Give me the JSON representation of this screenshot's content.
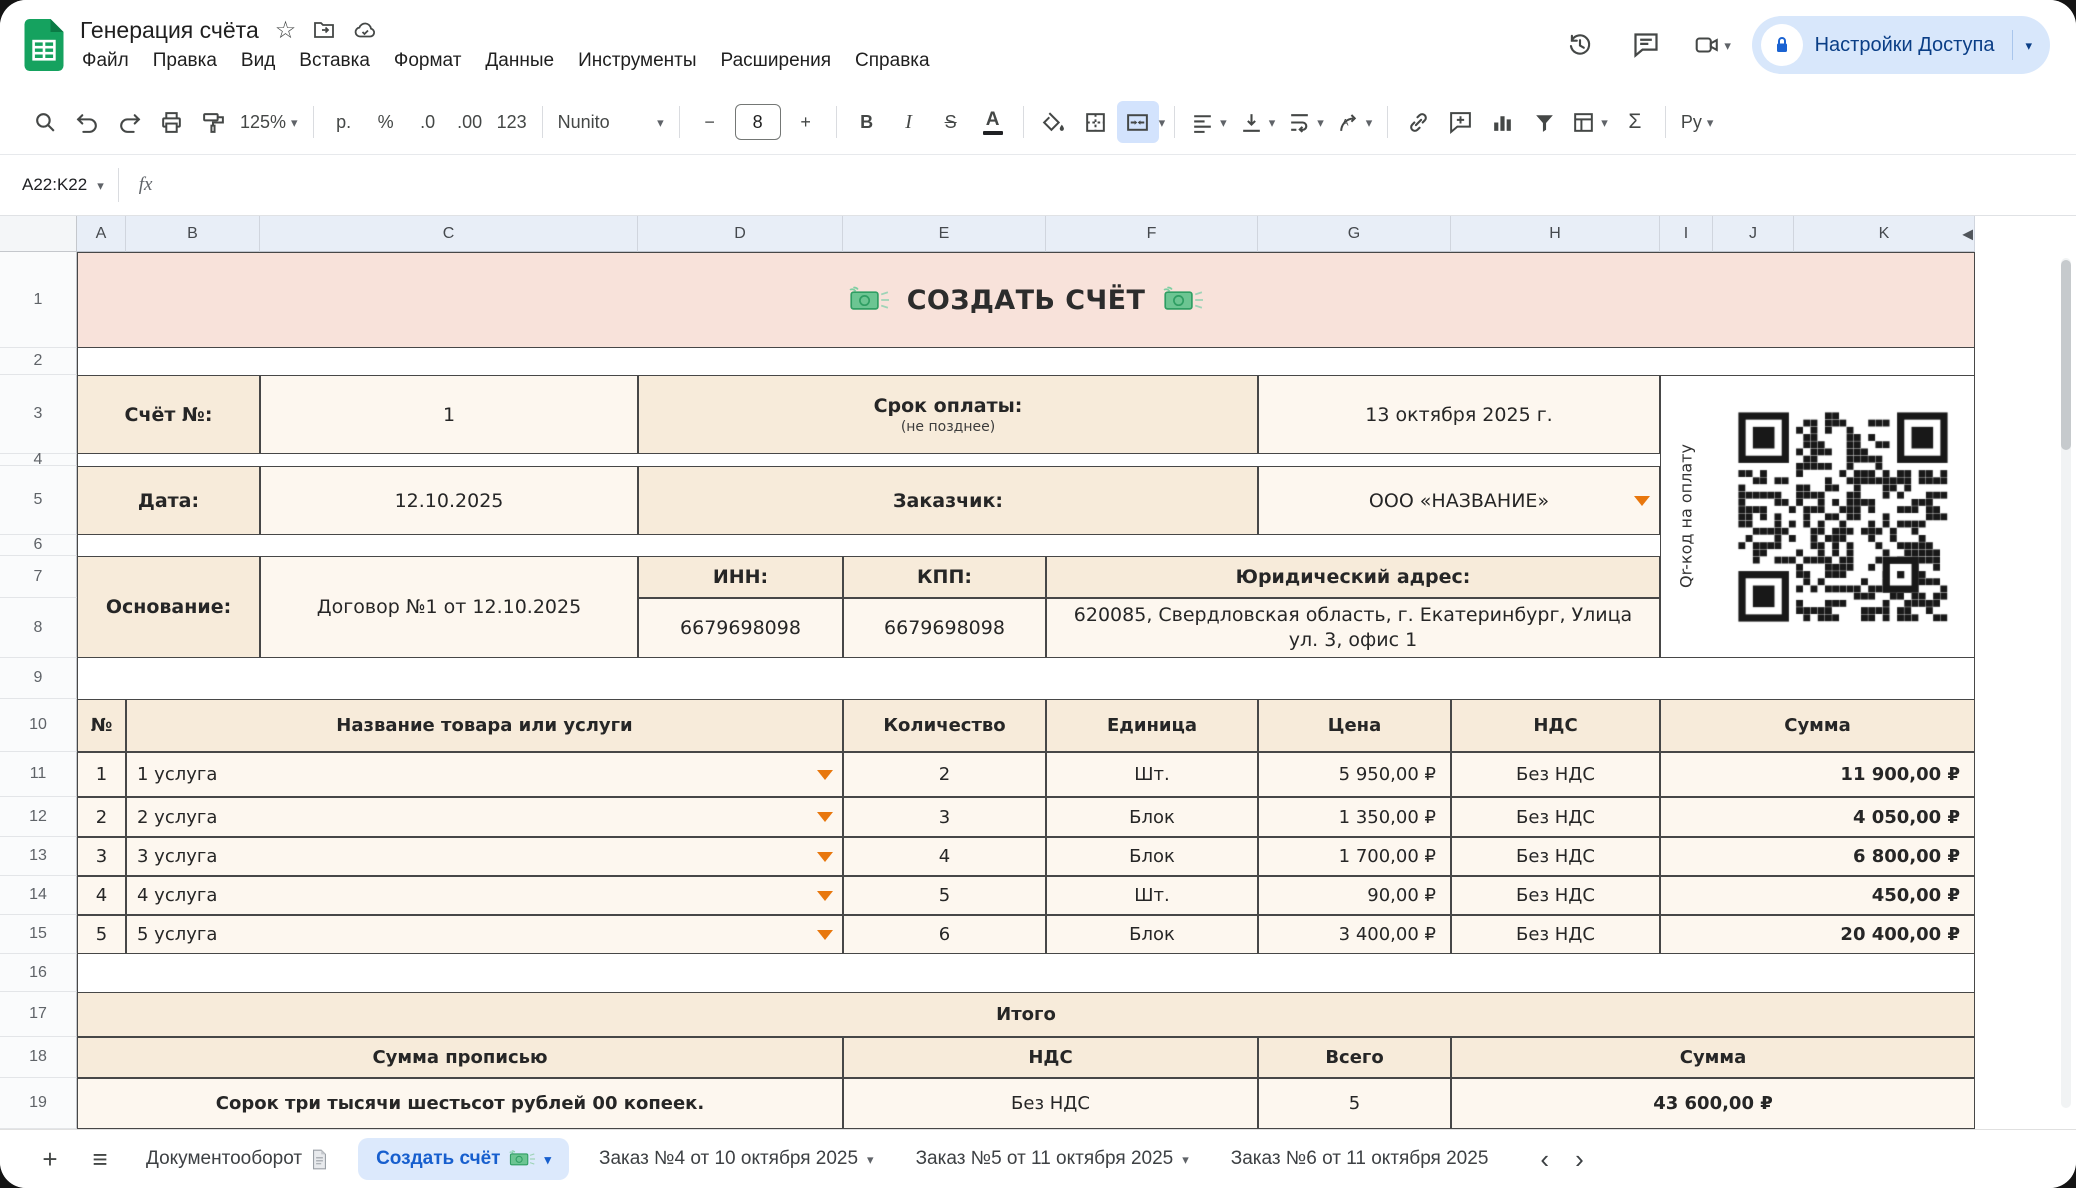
{
  "header": {
    "title": "Генерация счёта",
    "menus": [
      "Файл",
      "Правка",
      "Вид",
      "Вставка",
      "Формат",
      "Данные",
      "Инструменты",
      "Расширения",
      "Справка"
    ],
    "share_button": "Настройки Доступа"
  },
  "toolbar": {
    "zoom": "125%",
    "currency": "р.",
    "percent": "%",
    "dec_decrease": ".0",
    "dec_increase": ".00",
    "format_123": "123",
    "font": "Nunito",
    "font_size": "8",
    "sigma": "Σ",
    "input_lang": "Ру"
  },
  "formula_bar": {
    "name_box": "A22:K22",
    "fx": "fx"
  },
  "grid": {
    "columns": [
      "A",
      "B",
      "C",
      "D",
      "E",
      "F",
      "G",
      "H",
      "I",
      "J",
      "K"
    ],
    "rows": [
      "1",
      "2",
      "3",
      "4",
      "5",
      "6",
      "7",
      "8",
      "9",
      "10",
      "11",
      "12",
      "13",
      "14",
      "15",
      "16",
      "17",
      "18",
      "19"
    ],
    "col_marker": "◀"
  },
  "icons": {
    "caret": "▾",
    "plus": "+",
    "minus": "−",
    "hamburger": "≡",
    "star": "☆",
    "scroll_left": "‹",
    "scroll_right": "›"
  },
  "invoice": {
    "banner": {
      "emoji": "💸",
      "text": "СОЗДАТЬ СЧЁТ"
    },
    "fields": {
      "invoice_no_label": "Счёт №:",
      "invoice_no": "1",
      "due_label": "Срок оплаты:",
      "due_sub": "(не позднее)",
      "due_value": "13 октября 2025 г.",
      "date_label": "Дата:",
      "date_value": "12.10.2025",
      "customer_label": "Заказчик:",
      "customer_value": "ООО «НАЗВАНИЕ»",
      "basis_label": "Основание:",
      "basis_value": "Договор №1 от 12.10.2025",
      "inn_label": "ИНН:",
      "inn_value": "6679698098",
      "kpp_label": "КПП:",
      "kpp_value": "6679698098",
      "address_label": "Юридический адрес:",
      "address_value": "620085, Свердловская область, г. Екатеринбург, Улица ул. 3, офис 1",
      "qr_label": "Qr-код на оплату"
    },
    "items": {
      "headers": [
        "№",
        "Название товара или услуги",
        "Количество",
        "Единица",
        "Цена",
        "НДС",
        "Сумма"
      ],
      "rows": [
        {
          "num": "1",
          "name": "1 услуга",
          "qty": "2",
          "unit": "Шт.",
          "price": "5 950,00 ₽",
          "vat": "Без НДС",
          "total": "11 900,00 ₽"
        },
        {
          "num": "2",
          "name": "2 услуга",
          "qty": "3",
          "unit": "Блок",
          "price": "1 350,00 ₽",
          "vat": "Без НДС",
          "total": "4 050,00 ₽"
        },
        {
          "num": "3",
          "name": "3 услуга",
          "qty": "4",
          "unit": "Блок",
          "price": "1 700,00 ₽",
          "vat": "Без НДС",
          "total": "6 800,00 ₽"
        },
        {
          "num": "4",
          "name": "4 услуга",
          "qty": "5",
          "unit": "Шт.",
          "price": "90,00 ₽",
          "vat": "Без НДС",
          "total": "450,00 ₽"
        },
        {
          "num": "5",
          "name": "5 услуга",
          "qty": "6",
          "unit": "Блок",
          "price": "3 400,00 ₽",
          "vat": "Без НДС",
          "total": "20 400,00 ₽"
        }
      ]
    },
    "totals": {
      "title": "Итого",
      "words_header": "Сумма прописью",
      "vat_header": "НДС",
      "count_header": "Всего",
      "sum_header": "Сумма",
      "words_value": "Сорок три тысячи шестьсот рублей 00 копеек.",
      "vat_value": "Без НДС",
      "count_value": "5",
      "sum_value": "43 600,00 ₽"
    }
  },
  "tabbar": {
    "tabs": [
      {
        "label": "Документооборот",
        "emoji": "📄"
      },
      {
        "label": "Создать счёт",
        "emoji": "💸",
        "active": true
      },
      {
        "label": "Заказ №4 от 10 октября 2025"
      },
      {
        "label": "Заказ №5 от 11 октября 2025"
      },
      {
        "label": "Заказ №6 от 11 октября 2025"
      }
    ]
  },
  "colors": {
    "accent_blue": "#1a67d2",
    "sheets_green": "#15a25f",
    "label_peach": "#f7ebda",
    "banner_pink": "#f8e2da",
    "dropdown_orange": "#e8770d",
    "border_dark": "#474747"
  }
}
